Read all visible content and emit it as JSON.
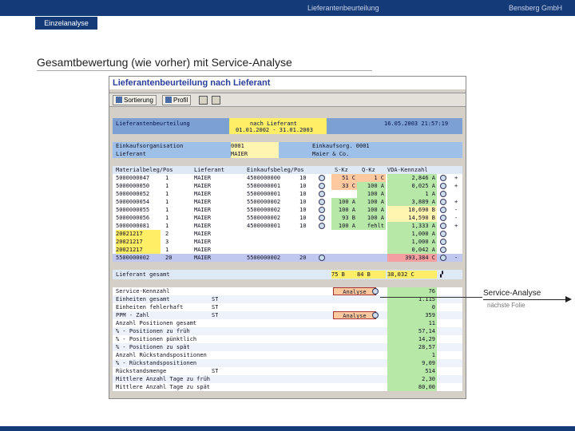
{
  "header": {
    "center": "Lieferantenbeurteilung",
    "right": "Bensberg GmbH",
    "tab": "Einzelanalyse"
  },
  "slide_title": "Gesamtbewertung (wie vorher) mit Service-Analyse",
  "sap": {
    "title": "Lieferantenbeurteilung nach Lieferant",
    "toolbar": {
      "sort": "Sortierung",
      "profile": "Profil"
    },
    "top": {
      "left": "Lieferantenbeurteilung",
      "mid1": "nach Lieferant",
      "mid2": "01.01.2002 - 31.01.2003",
      "right": "16.05.2003 21:57:19"
    },
    "org": {
      "l1": "Einkaufsorganisation",
      "v1": "0001",
      "r1": "Einkaufsorg. 0001",
      "l2": "Lieferant",
      "v2": "MAIER",
      "r2": "Maier & Co."
    },
    "cols": [
      "Materialbeleg/Pos",
      "Lieferant",
      "Einkaufsbeleg/Pos",
      "S-Kz",
      "Q-Kz",
      "VDA-Kennzahl"
    ],
    "rows": [
      {
        "mat": "5000000047",
        "pos": "1",
        "lief": "MAIER",
        "ek": "4500000000",
        "ekpos": "10",
        "s": "51 C",
        "q": "1 C",
        "vda": "2,846 A",
        "sym": "+"
      },
      {
        "mat": "5000000050",
        "pos": "1",
        "lief": "MAIER",
        "ek": "5500000001",
        "ekpos": "10",
        "s": "33 C",
        "q": "100 A",
        "vda": "0,025 A",
        "sym": "+"
      },
      {
        "mat": "5000000052",
        "pos": "1",
        "lief": "MAIER",
        "ek": "5500000001",
        "ekpos": "10",
        "s": "",
        "q": "100 A",
        "vda": "1 A",
        "sym": ""
      },
      {
        "mat": "5000000054",
        "pos": "1",
        "lief": "MAIER",
        "ek": "5500000002",
        "ekpos": "10",
        "s": "100 A",
        "q": "100 A",
        "vda": "3,889 A",
        "sym": "+"
      },
      {
        "mat": "5000000055",
        "pos": "1",
        "lief": "MAIER",
        "ek": "5500000002",
        "ekpos": "10",
        "s": "100 A",
        "q": "100 A",
        "vda": "10,690 B",
        "sym": "-"
      },
      {
        "mat": "5000000056",
        "pos": "1",
        "lief": "MAIER",
        "ek": "5500000002",
        "ekpos": "10",
        "s": "93 B",
        "q": "100 A",
        "vda": "14,590 B",
        "sym": "-"
      },
      {
        "mat": "5000000081",
        "pos": "1",
        "lief": "MAIER",
        "ek": "4500000001",
        "ekpos": "10",
        "s": "100 A",
        "q": "fehlt",
        "vda": "1,333 A",
        "sym": "+"
      },
      {
        "mat": "20021217",
        "pos": "2",
        "lief": "MAIER",
        "ek": "",
        "ekpos": "",
        "s": "",
        "q": "",
        "vda": "1,000 A",
        "sym": ""
      },
      {
        "mat": "20021217",
        "pos": "3",
        "lief": "MAIER",
        "ek": "",
        "ekpos": "",
        "s": "",
        "q": "",
        "vda": "1,000 A",
        "sym": ""
      },
      {
        "mat": "20021217",
        "pos": "1",
        "lief": "MAIER",
        "ek": "",
        "ekpos": "",
        "s": "",
        "q": "",
        "vda": "0,042 A",
        "sym": ""
      },
      {
        "mat": "5500000002",
        "pos": "20",
        "lief": "MAIER",
        "ek": "5500000002",
        "ekpos": "20",
        "s": "",
        "q": "",
        "vda": "393,384 C",
        "sym": "-"
      }
    ],
    "total": {
      "label": "Lieferant gesamt",
      "s": "75 B",
      "q": "84 B",
      "vda": "38,032 C"
    },
    "service": [
      {
        "l": "Service-Kennzahl",
        "u": "",
        "v": "76",
        "btn": "Analyse"
      },
      {
        "l": "Einheiten gesamt",
        "u": "ST",
        "v": "1.115",
        "btn": ""
      },
      {
        "l": "Einheiten fehlerhaft",
        "u": "ST",
        "v": "0",
        "btn": ""
      },
      {
        "l": "PPM - Zahl",
        "u": "ST",
        "v": "359",
        "btn": "Analyse"
      },
      {
        "l": "Anzahl Positionen gesamt",
        "u": "",
        "v": "11",
        "btn": ""
      },
      {
        "l": "% - Positionen zu früh",
        "u": "",
        "v": "57,14",
        "btn": ""
      },
      {
        "l": "% - Positionen pünktlich",
        "u": "",
        "v": "14,29",
        "btn": ""
      },
      {
        "l": "% - Positionen zu spät",
        "u": "",
        "v": "28,57",
        "btn": ""
      },
      {
        "l": "Anzahl Rückstandspositionen",
        "u": "",
        "v": "1",
        "btn": ""
      },
      {
        "l": "% - Rückstandspositionen",
        "u": "",
        "v": "9,09",
        "btn": ""
      },
      {
        "l": "Rückstandsmenge",
        "u": "ST",
        "v": "514",
        "btn": ""
      },
      {
        "l": "Mittlere Anzahl Tage zu früh",
        "u": "",
        "v": "2,30",
        "btn": ""
      },
      {
        "l": "Mittlere Anzahl Tage zu spät",
        "u": "",
        "v": "80,00",
        "btn": ""
      }
    ]
  },
  "legend": {
    "label": "Service-Analyse",
    "sub": "nächste Folie"
  }
}
